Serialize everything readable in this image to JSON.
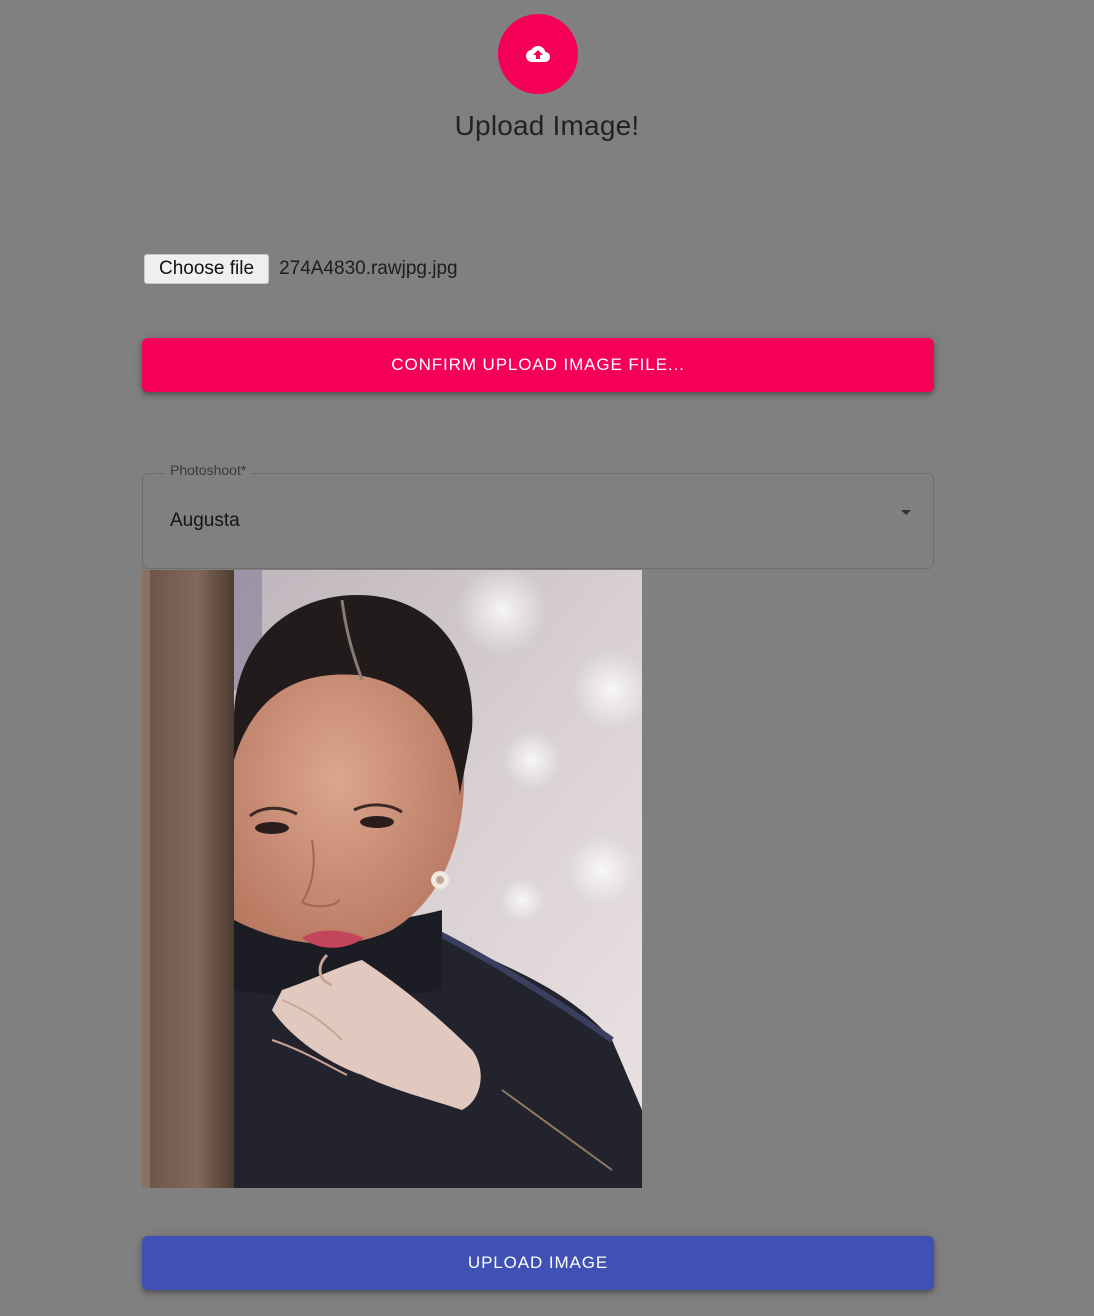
{
  "header": {
    "icon": "cloud-upload-icon",
    "title": "Upload Image!"
  },
  "file_input": {
    "button_label": "Choose file",
    "file_name": "274A4830.rawjpg.jpg"
  },
  "confirm_button": {
    "label": "CONFIRM UPLOAD IMAGE FILE..."
  },
  "photoshoot_select": {
    "label": "Photoshoot*",
    "value": "Augusta",
    "icon": "chevron-down-icon"
  },
  "preview": {
    "alt": "uploaded portrait preview"
  },
  "upload_button": {
    "label": "UPLOAD IMAGE"
  },
  "colors": {
    "background": "#808080",
    "accent_pink": "#f50057",
    "primary_blue": "#3f51b5"
  }
}
